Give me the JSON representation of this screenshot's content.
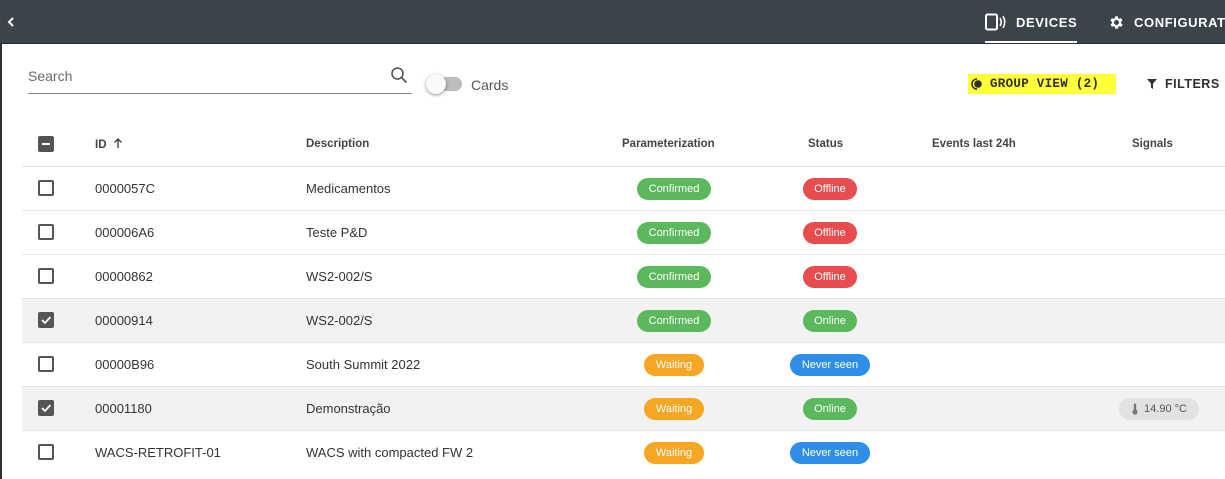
{
  "topbar": {
    "tabs": [
      {
        "label": "DEVICES",
        "icon": "devices-icon",
        "active": true
      },
      {
        "label": "CONFIGURAT",
        "icon": "gear-icon",
        "active": false
      }
    ]
  },
  "toolbar": {
    "search_placeholder": "Search",
    "cards_label": "Cards",
    "group_view_label": "GROUP VIEW (2)",
    "filters_label": "FILTERS"
  },
  "table": {
    "columns": [
      "ID",
      "Description",
      "Parameterization",
      "Status",
      "Events last 24h",
      "Signals"
    ],
    "rows": [
      {
        "id": "0000057C",
        "description": "Medicamentos",
        "parameterization": "Confirmed",
        "status": "Offline",
        "checked": false,
        "signal": ""
      },
      {
        "id": "000006A6",
        "description": "Teste P&D",
        "parameterization": "Confirmed",
        "status": "Offline",
        "checked": false,
        "signal": ""
      },
      {
        "id": "00000862",
        "description": "WS2-002/S",
        "parameterization": "Confirmed",
        "status": "Offline",
        "checked": false,
        "signal": ""
      },
      {
        "id": "00000914",
        "description": "WS2-002/S",
        "parameterization": "Confirmed",
        "status": "Online",
        "checked": true,
        "signal": ""
      },
      {
        "id": "00000B96",
        "description": "South Summit 2022",
        "parameterization": "Waiting",
        "status": "Never seen",
        "checked": false,
        "signal": ""
      },
      {
        "id": "00001180",
        "description": "Demonstração",
        "parameterization": "Waiting",
        "status": "Online",
        "checked": true,
        "signal": "14.90 °C"
      },
      {
        "id": "WACS-RETROFIT-01",
        "description": "WACS with compacted FW 2",
        "parameterization": "Waiting",
        "status": "Never seen",
        "checked": false,
        "signal": ""
      }
    ]
  },
  "colors": {
    "topbar": "#3d434b",
    "confirmed": "#5cb85c",
    "waiting": "#f5a623",
    "offline": "#e84c4c",
    "online": "#5cb85c",
    "never_seen": "#2f8fe8",
    "highlight": "#ffff3a"
  }
}
